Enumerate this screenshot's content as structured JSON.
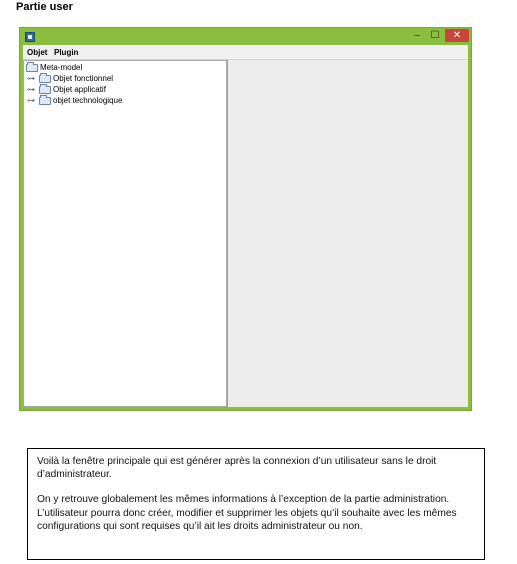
{
  "heading": "Partie user",
  "window": {
    "titlebar": {
      "icon": "java-app-icon",
      "minimize_label": "–",
      "maximize_label": "☐",
      "close_label": "✕",
      "accent_color": "#8bbe3e",
      "close_color": "#c9443b"
    },
    "menu": {
      "items": [
        {
          "label": "Objet"
        },
        {
          "label": "Plugin"
        }
      ]
    },
    "tree": {
      "root": {
        "label": "Meta-model",
        "icon": "folder-icon"
      },
      "children": [
        {
          "label": "Objet fonctionnel",
          "icon": "folder-icon",
          "expander": "expand-arrow-icon"
        },
        {
          "label": "Objet applicatif",
          "icon": "folder-icon",
          "expander": "expand-arrow-icon"
        },
        {
          "label": "objet technologique",
          "icon": "folder-icon",
          "expander": "expand-arrow-icon"
        }
      ]
    }
  },
  "note": {
    "paragraph1": "Voilà la fenêtre principale qui est générer après la connexion d’un utilisateur sans le droit d’administrateur.",
    "paragraph2": "On y retrouve globalement les mêmes informations à l’exception de la partie administration.",
    "paragraph3": "L’utilisateur pourra donc créer, modifier et supprimer les objets qu’il souhaite avec les mêmes configurations qui sont requises qu’il ait les droits administrateur ou non."
  }
}
